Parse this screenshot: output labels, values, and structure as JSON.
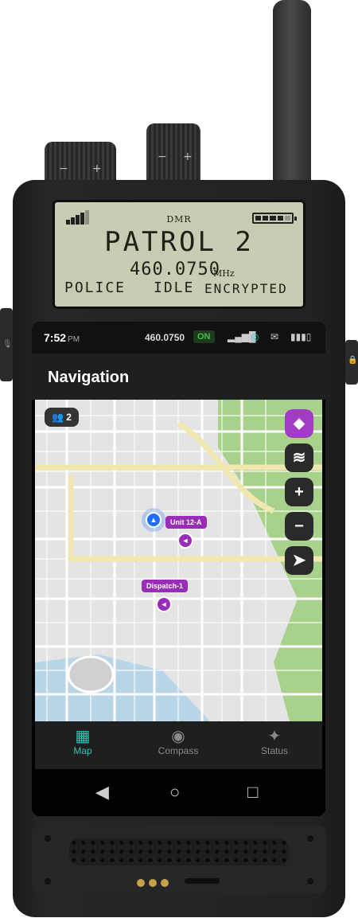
{
  "lcd": {
    "mode": "DMR",
    "channel": "PATROL 2",
    "frequency": "460.0750",
    "unit": "MHz",
    "status_left": "POLICE",
    "status_mid": "IDLE",
    "status_right": "ENCRYPTED"
  },
  "statusbar": {
    "time": "7:52",
    "ampm": "PM",
    "frequency": "460.0750",
    "tx_state": "ON"
  },
  "appbar": {
    "title": "Navigation"
  },
  "map": {
    "members_count": "2",
    "units": [
      {
        "label": "Unit 12-A"
      },
      {
        "label": "Dispatch-1"
      }
    ],
    "controls": [
      "tag-icon",
      "layers-icon",
      "zoom-in-icon",
      "zoom-out-icon",
      "locate-icon"
    ]
  },
  "bottomnav": {
    "items": [
      {
        "label": "Map",
        "icon": "map-icon",
        "active": true
      },
      {
        "label": "Compass",
        "icon": "compass-icon",
        "active": false
      },
      {
        "label": "Status",
        "icon": "satellite-icon",
        "active": false
      }
    ]
  },
  "knobs": {
    "minus": "−",
    "plus": "+"
  },
  "colors": {
    "accent": "#2ec4b6",
    "unit": "#9a2db8",
    "lcd_bg": "#c7cdb3",
    "self": "#1e6fff"
  }
}
